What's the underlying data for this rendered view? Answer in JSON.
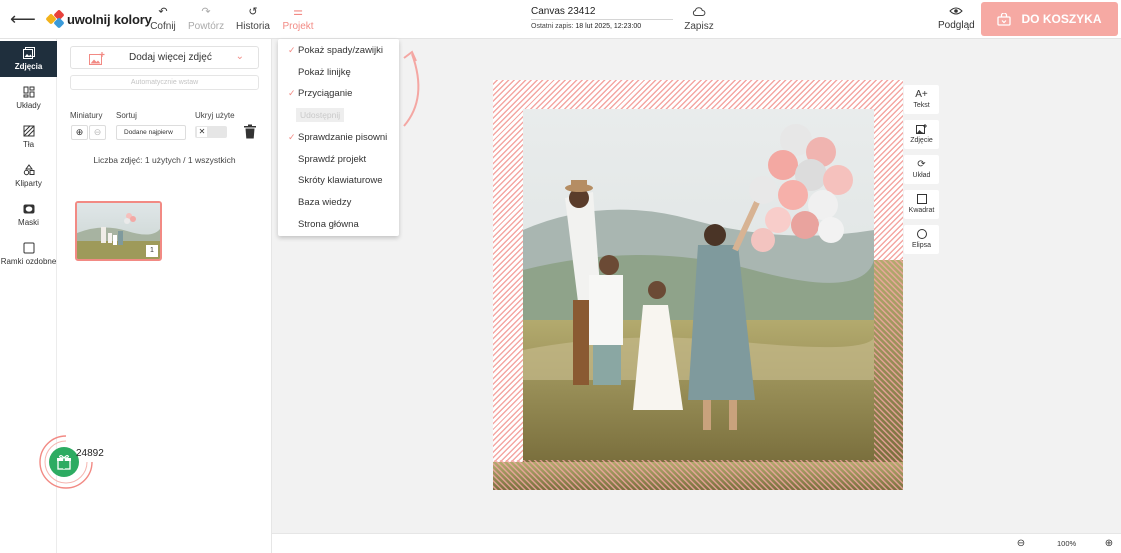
{
  "app": {
    "logo_text": "uwolnij kolory",
    "back_icon": "arrow-left-icon"
  },
  "toolbar": {
    "undo_label": "Cofnij",
    "redo_label": "Powtórz",
    "history_label": "Historia",
    "project_label": "Projekt",
    "canvas_name": "Canvas 23412",
    "last_save_label": "Ostatni zapis:",
    "last_save_value": "18 lut 2025, 12:23:00",
    "save_label": "Zapisz",
    "preview_label": "Podgląd",
    "cart_label": "DO KOSZYKA",
    "accent_color": "#f28a84",
    "cart_color": "#f6a9a3"
  },
  "sidebar": {
    "items": [
      {
        "label": "Zdjęcia",
        "icon": "photos-icon",
        "active": true
      },
      {
        "label": "Układy",
        "icon": "layouts-icon"
      },
      {
        "label": "Tła",
        "icon": "backgrounds-icon"
      },
      {
        "label": "Kliparty",
        "icon": "cliparts-icon"
      },
      {
        "label": "Maski",
        "icon": "masks-icon"
      },
      {
        "label": "Ramki ozdobne",
        "icon": "frames-icon"
      }
    ],
    "active_color": "#1f2f3d"
  },
  "photos_panel": {
    "add_photos_label": "Dodaj więcej zdjęć",
    "auto_fill_label": "Automatycznie wstaw",
    "thumbnails_label": "Miniatury",
    "sort_label": "Sortuj",
    "sort_value": "Dodane najpierw",
    "hide_used_label": "Ukryj użyte",
    "count_text": "Liczba zdjęć: 1 użytych / 1 wszystkich",
    "photos": [
      {
        "usage_count": "1"
      }
    ]
  },
  "gift": {
    "count": "24892",
    "icon": "gift-icon",
    "color": "#2dab62"
  },
  "project_menu": {
    "items": [
      {
        "label": "Pokaż spady/zawijki",
        "checked": true
      },
      {
        "label": "Pokaż linijkę",
        "checked": false
      },
      {
        "label": "Przyciąganie",
        "checked": true
      },
      {
        "label": "Udostępnij",
        "checked": false,
        "disabled": true
      },
      {
        "label": "Sprawdzanie pisowni",
        "checked": true
      },
      {
        "label": "Sprawdź projekt",
        "checked": false
      },
      {
        "label": "Skróty klawiaturowe",
        "checked": false
      },
      {
        "label": "Baza wiedzy",
        "checked": false
      },
      {
        "label": "Strona główna",
        "checked": false
      }
    ]
  },
  "side_tools": [
    {
      "label": "Tekst",
      "icon": "text-add-icon"
    },
    {
      "label": "Zdjęcie",
      "icon": "image-add-icon"
    },
    {
      "label": "Układ",
      "icon": "refresh-layout-icon"
    },
    {
      "label": "Kwadrat",
      "icon": "square-icon"
    },
    {
      "label": "Elipsa",
      "icon": "circle-icon"
    }
  ],
  "zoom": {
    "value": "100%"
  }
}
